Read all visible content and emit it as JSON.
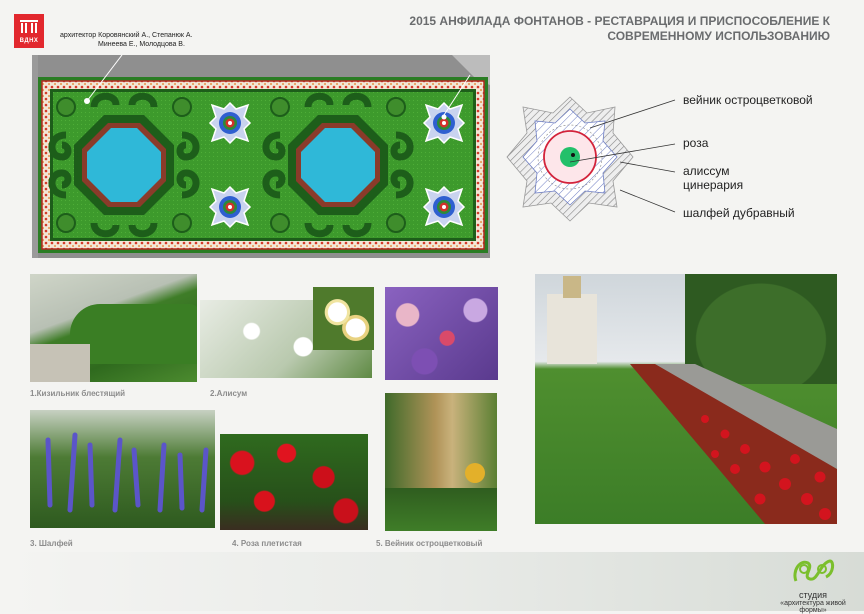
{
  "logo": {
    "text": "ВДНХ"
  },
  "authors": {
    "line1": "архитектор Коровянский А., Степанюк А.",
    "line2": "Минеева Е., Молодцова В."
  },
  "title": {
    "line1": "2015 АНФИЛАДА ФОНТАНОВ - РЕСТАВРАЦИЯ И ПРИСПОСОБЛЕНИЕ К",
    "line2": "СОВРЕМЕННОМУ ИСПОЛЬЗОВАНИЮ"
  },
  "legend": {
    "item1": "вейник остроцветковой",
    "item2": "роза",
    "item3a": "алиссум",
    "item3b": "цинерария",
    "item4": "шалфей дубравный"
  },
  "captions": {
    "c1": "1.Кизильник блестящий",
    "c2": "2.Алисум",
    "c3": "3. Шалфей",
    "c4": "4. Роза плетистая",
    "c5": "5. Вейник остроцветковый"
  },
  "studio": {
    "name": "студия",
    "sub": "«архитектура живой формы»"
  },
  "colors": {
    "accent_red": "#e2282e",
    "title_gray": "#6a6c6e",
    "lawn_green": "#3d9a2c",
    "hedge_green": "#1d5e1a",
    "water": "#2fb8d8"
  }
}
